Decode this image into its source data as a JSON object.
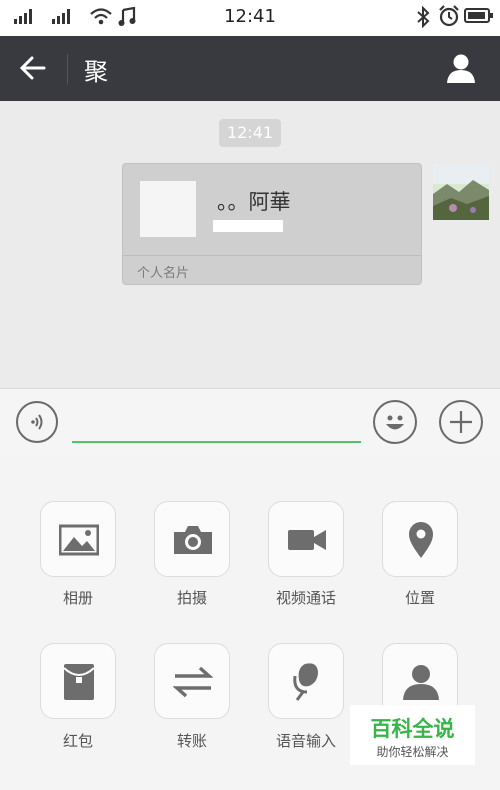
{
  "status_bar": {
    "time": "12:41"
  },
  "header": {
    "title": "聚"
  },
  "chat": {
    "timestamp": "12:41",
    "card": {
      "name": "。。阿華",
      "label": "个人名片"
    }
  },
  "panel": {
    "items": [
      {
        "label": "相册",
        "icon": "photo-album-icon"
      },
      {
        "label": "拍摄",
        "icon": "camera-icon"
      },
      {
        "label": "视频通话",
        "icon": "video-call-icon"
      },
      {
        "label": "位置",
        "icon": "location-pin-icon"
      },
      {
        "label": "红包",
        "icon": "red-packet-icon"
      },
      {
        "label": "转账",
        "icon": "transfer-icon"
      },
      {
        "label": "语音输入",
        "icon": "microphone-icon"
      },
      {
        "label": "",
        "icon": "contact-card-icon"
      }
    ]
  },
  "watermark": {
    "title": "百科全说",
    "subtitle": "助你轻松解决"
  },
  "colors": {
    "header_bg": "#393a3f",
    "input_underline": "#4fc36a",
    "watermark_green": "#38b449"
  }
}
